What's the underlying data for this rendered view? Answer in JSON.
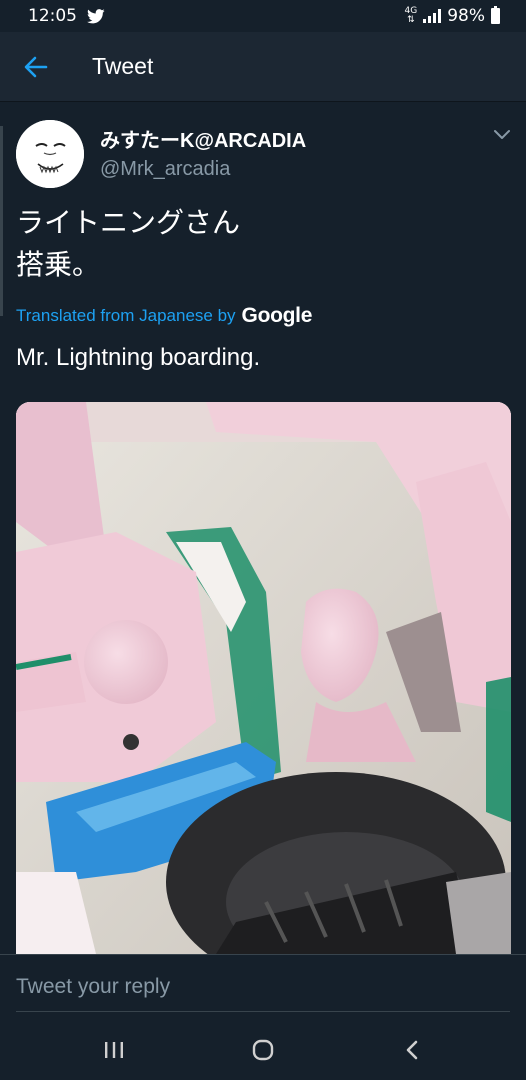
{
  "status_bar": {
    "time": "12:05",
    "network": "4G",
    "battery": "98%",
    "icons": [
      "twitter-bird-icon",
      "signal-icon",
      "battery-icon"
    ]
  },
  "app_bar": {
    "title": "Tweet",
    "back_icon": "back-arrow-icon"
  },
  "tweet": {
    "display_name": "みすたーK@ARCADIA",
    "handle": "@Mrk_arcadia",
    "original_text": "ライトニングさん\n搭乗。",
    "translation_label": "Translated from Japanese by",
    "translation_provider": "Google",
    "translated_text": "Mr. Lightning boarding."
  },
  "reply": {
    "placeholder": "Tweet your reply"
  },
  "system_nav": {
    "buttons": [
      "recents-icon",
      "home-icon",
      "back-icon"
    ]
  },
  "colors": {
    "background": "#15202b",
    "app_bar": "#1c2733",
    "accent": "#1da1f2",
    "secondary_text": "#8899a6",
    "divider": "#38444d"
  }
}
